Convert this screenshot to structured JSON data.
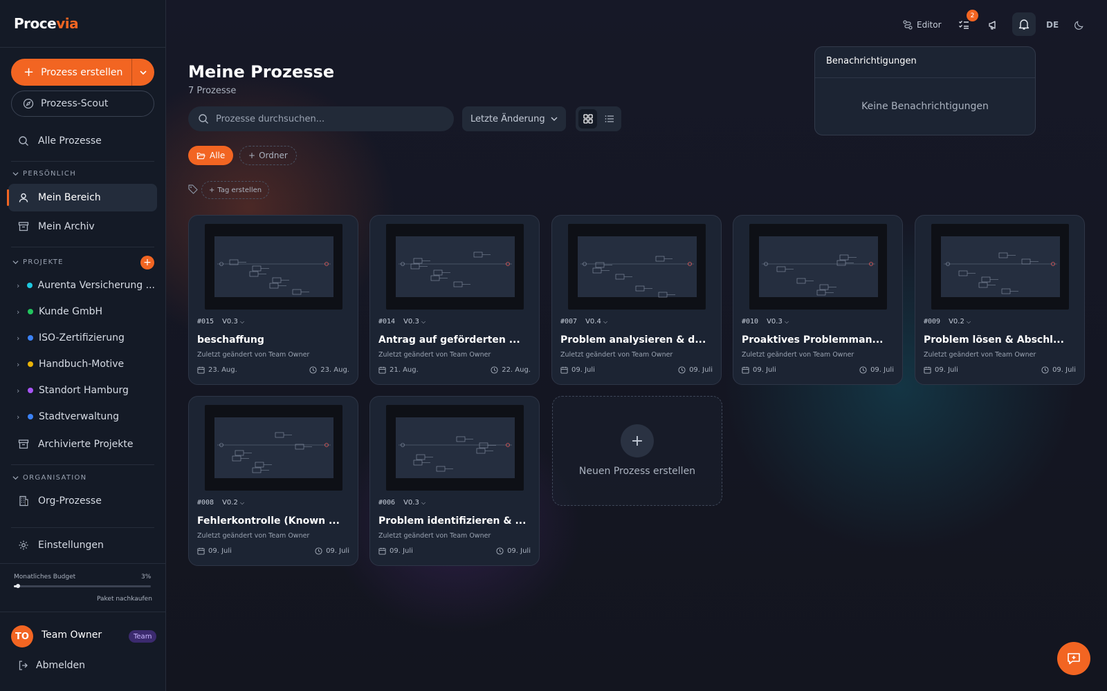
{
  "app": {
    "logo_part1": "Proce",
    "logo_part2": "via",
    "brand_color": "#f26522"
  },
  "sidebar": {
    "create_button": "Prozess erstellen",
    "scout_button": "Prozess-Scout",
    "all_processes": "Alle Prozesse",
    "section_personal": "PERSÖNLICH",
    "my_area": "Mein Bereich",
    "my_archive": "Mein Archiv",
    "section_projects": "PROJEKTE",
    "projects": [
      {
        "label": "Aurenta Versicherung ...",
        "color": "#1ec8e0"
      },
      {
        "label": "Kunde GmbH",
        "color": "#22c55e"
      },
      {
        "label": "ISO-Zertifizierung",
        "color": "#3b82f6"
      },
      {
        "label": "Handbuch-Motive",
        "color": "#eab308"
      },
      {
        "label": "Standort Hamburg",
        "color": "#a855f7"
      },
      {
        "label": "Stadtverwaltung",
        "color": "#3b82f6"
      }
    ],
    "archived_projects": "Archivierte Projekte",
    "section_org": "ORGANISATION",
    "org_processes": "Org-Prozesse",
    "settings": "Einstellungen",
    "budget_label": "Monatliches Budget",
    "budget_percent": "3%",
    "budget_fraction": 0.03,
    "buy_package": "Paket nachkaufen",
    "user_initials": "TO",
    "user_name": "Team Owner",
    "user_badge": "Team",
    "logout": "Abmelden"
  },
  "topbar": {
    "editor": "Editor",
    "tasks_badge": "2",
    "language": "DE"
  },
  "main": {
    "title": "Meine Prozesse",
    "count": "7 Prozesse",
    "search_placeholder": "Prozesse durchsuchen...",
    "sort_label": "Letzte Änderung",
    "filter_all": "Alle",
    "filter_folder": "Ordner",
    "tag_create": "Tag erstellen",
    "new_process": "Neuen Prozess erstellen"
  },
  "cards": [
    {
      "number": "#015",
      "version": "V0.3",
      "title": "beschaffung",
      "subtitle": "Zuletzt geändert von Team Owner",
      "created": "23. Aug.",
      "modified": "23. Aug."
    },
    {
      "number": "#014",
      "version": "V0.3",
      "title": "Antrag auf geförderten ...",
      "subtitle": "Zuletzt geändert von Team Owner",
      "created": "21. Aug.",
      "modified": "22. Aug."
    },
    {
      "number": "#007",
      "version": "V0.4",
      "title": "Problem analysieren & d...",
      "subtitle": "Zuletzt geändert von Team Owner",
      "created": "09. Juli",
      "modified": "09. Juli"
    },
    {
      "number": "#010",
      "version": "V0.3",
      "title": "Proaktives Problemman...",
      "subtitle": "Zuletzt geändert von Team Owner",
      "created": "09. Juli",
      "modified": "09. Juli"
    },
    {
      "number": "#009",
      "version": "V0.2",
      "title": "Problem lösen & Abschl...",
      "subtitle": "Zuletzt geändert von Team Owner",
      "created": "09. Juli",
      "modified": "09. Juli"
    },
    {
      "number": "#008",
      "version": "V0.2",
      "title": "Fehlerkontrolle (Known ...",
      "subtitle": "Zuletzt geändert von Team Owner",
      "created": "09. Juli",
      "modified": "09. Juli"
    },
    {
      "number": "#006",
      "version": "V0.3",
      "title": "Problem identifizieren & ...",
      "subtitle": "Zuletzt geändert von Team Owner",
      "created": "09. Juli",
      "modified": "09. Juli"
    }
  ],
  "notifications": {
    "title": "Benachrichtigungen",
    "empty": "Keine Benachrichtigungen"
  }
}
